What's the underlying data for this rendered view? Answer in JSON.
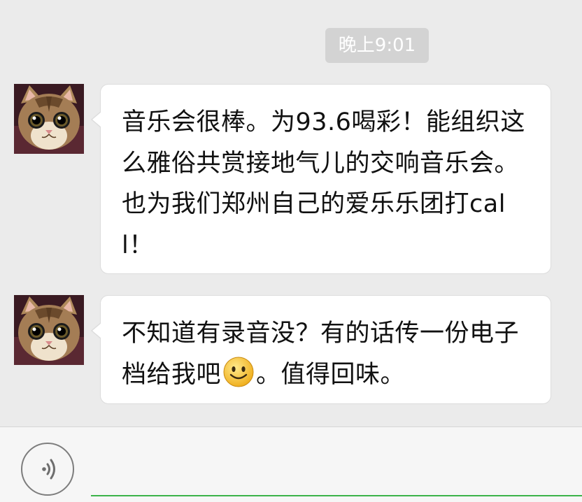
{
  "timestamp": "晚上9:01",
  "messages": [
    {
      "sender_avatar": "cat-avatar",
      "text": "音乐会很棒。为93.6喝彩！能组织这么雅俗共赏接地气儿的交响音乐会。也为我们郑州自己的爱乐乐团打call！"
    },
    {
      "sender_avatar": "cat-avatar",
      "text_before_emoji": "不知道有录音没？有的话传一份电子档给我吧",
      "emoji": "smile-emoji",
      "text_after_emoji": "。值得回味。"
    }
  ],
  "input_bar": {
    "voice_icon": "voice-icon",
    "accent_color": "#3cb34a"
  },
  "colors": {
    "background": "#ebebeb",
    "bubble": "#ffffff",
    "timestamp_bg": "#d3d3d3"
  }
}
